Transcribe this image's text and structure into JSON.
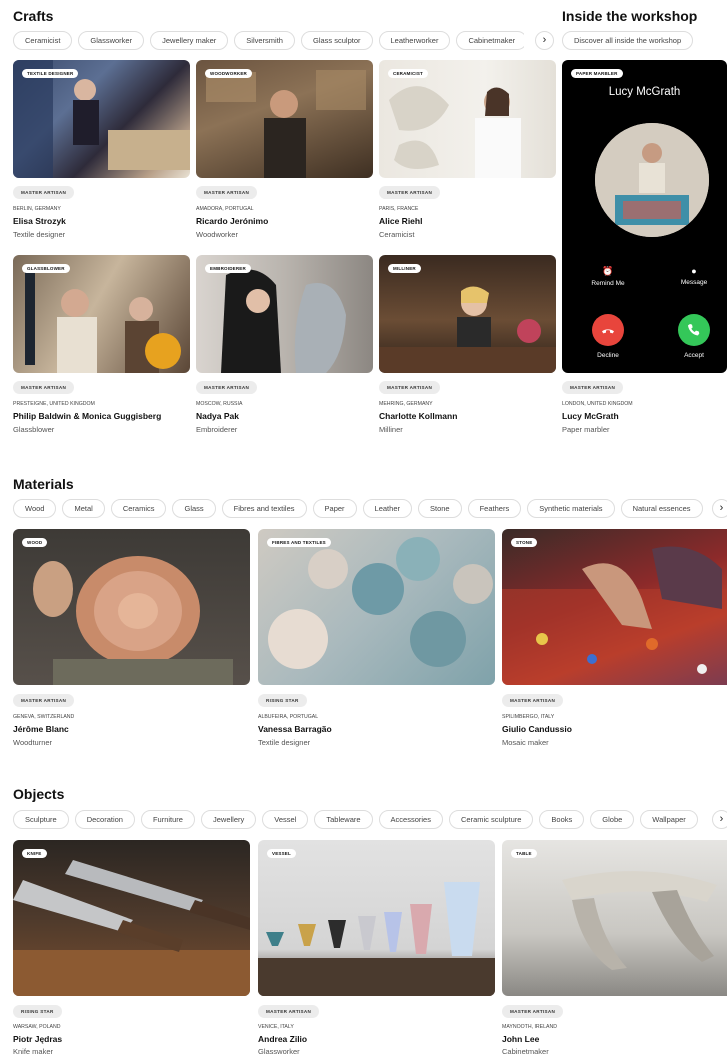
{
  "crafts": {
    "title": "Crafts",
    "chips": [
      "Ceramicist",
      "Glassworker",
      "Jewellery maker",
      "Silversmith",
      "Glass sculptor",
      "Leatherworker",
      "Cabinetmaker"
    ],
    "cards": [
      {
        "tag": "Textile designer",
        "badge": "Master artisan",
        "location": "Berlin, Germany",
        "name": "Elisa Strozyk",
        "role": "Textile designer"
      },
      {
        "tag": "Woodworker",
        "badge": "Master artisan",
        "location": "Amadora, Portugal",
        "name": "Ricardo Jerónimo",
        "role": "Woodworker"
      },
      {
        "tag": "Ceramicist",
        "badge": "Master artisan",
        "location": "Paris, France",
        "name": "Alice Riehl",
        "role": "Ceramicist"
      },
      {
        "tag": "Glassblower",
        "badge": "Master artisan",
        "location": "Presteigne, United Kingdom",
        "name": "Philip Baldwin & Monica Guggisberg",
        "role": "Glassblower"
      },
      {
        "tag": "Embroiderer",
        "badge": "Master artisan",
        "location": "Moscow, Russia",
        "name": "Nadya Pak",
        "role": "Embroiderer"
      },
      {
        "tag": "Milliner",
        "badge": "Master artisan",
        "location": "Mehring, Germany",
        "name": "Charlotte Kollmann",
        "role": "Milliner"
      }
    ]
  },
  "workshop": {
    "title": "Inside the workshop",
    "chip": "Discover all inside the workshop",
    "tag": "Paper marbler",
    "caller": "Lucy McGrath",
    "remind": "Remind Me",
    "message": "Message",
    "decline": "Decline",
    "accept": "Accept",
    "badge": "Master artisan",
    "location": "London, United Kingdom",
    "name": "Lucy McGrath",
    "role": "Paper marbler"
  },
  "materials": {
    "title": "Materials",
    "chips": [
      "Wood",
      "Metal",
      "Ceramics",
      "Glass",
      "Fibres and textiles",
      "Paper",
      "Leather",
      "Stone",
      "Feathers",
      "Synthetic materials",
      "Natural essences"
    ],
    "cards": [
      {
        "tag": "Wood",
        "badge": "Master artisan",
        "location": "Geneva, Switzerland",
        "name": "Jérôme Blanc",
        "role": "Woodturner"
      },
      {
        "tag": "Fibres and textiles",
        "badge": "Rising star",
        "location": "Albufeira, Portugal",
        "name": "Vanessa Barragão",
        "role": "Textile designer"
      },
      {
        "tag": "Stone",
        "badge": "Master artisan",
        "location": "Spilimbergo, Italy",
        "name": "Giulio Candussio",
        "role": "Mosaic maker"
      }
    ]
  },
  "objects": {
    "title": "Objects",
    "chips": [
      "Sculpture",
      "Decoration",
      "Furniture",
      "Jewellery",
      "Vessel",
      "Tableware",
      "Accessories",
      "Ceramic sculpture",
      "Books",
      "Globe",
      "Wallpaper"
    ],
    "cards": [
      {
        "tag": "Knife",
        "badge": "Rising star",
        "location": "Warsaw, Poland",
        "name": "Piotr Jędras",
        "role": "Knife maker"
      },
      {
        "tag": "Vessel",
        "badge": "Master artisan",
        "location": "Venice, Italy",
        "name": "Andrea Zilio",
        "role": "Glassworker"
      },
      {
        "tag": "Table",
        "badge": "Master artisan",
        "location": "Maynooth, Ireland",
        "name": "John Lee",
        "role": "Cabinetmaker"
      }
    ]
  },
  "icons": {
    "chevron": "chevron-right-icon",
    "alarm": "alarm-clock-icon",
    "message": "message-bubble-icon",
    "decline": "phone-hang-up-icon",
    "accept": "phone-icon"
  },
  "colors": {
    "decline": "#e8453c",
    "accept": "#34c759",
    "chip_border": "#dddddd",
    "badge_bg": "#ececec"
  }
}
